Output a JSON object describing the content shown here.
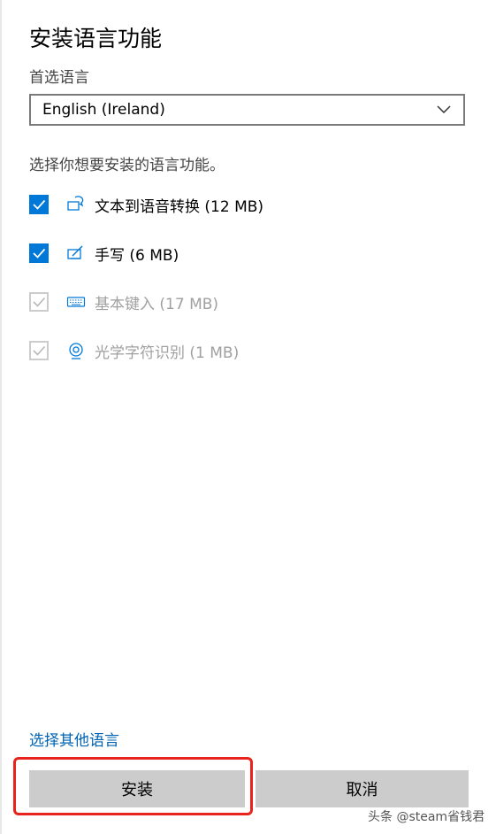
{
  "dialog": {
    "title": "安装语言功能",
    "preferred_language_label": "首选语言",
    "language_select": {
      "value": "English (Ireland)"
    },
    "instruction": "选择你想要安装的语言功能。",
    "features": [
      {
        "label": "文本到语音转换 (12 MB)",
        "checked": true,
        "enabled": true,
        "icon": "speech-icon"
      },
      {
        "label": "手写 (6 MB)",
        "checked": true,
        "enabled": true,
        "icon": "handwriting-icon"
      },
      {
        "label": "基本键入 (17 MB)",
        "checked": true,
        "enabled": false,
        "icon": "keyboard-icon"
      },
      {
        "label": "光学字符识别 (1 MB)",
        "checked": true,
        "enabled": false,
        "icon": "ocr-icon"
      }
    ],
    "other_language_link": "选择其他语言",
    "install_button": "安装",
    "cancel_button": "取消"
  },
  "watermark": "头条 @steam省钱君",
  "colors": {
    "accent": "#0078d7",
    "link": "#0063b1",
    "button_bg": "#cccccc",
    "highlight_box": "#e8231e",
    "disabled_text": "#a0a0a0"
  }
}
